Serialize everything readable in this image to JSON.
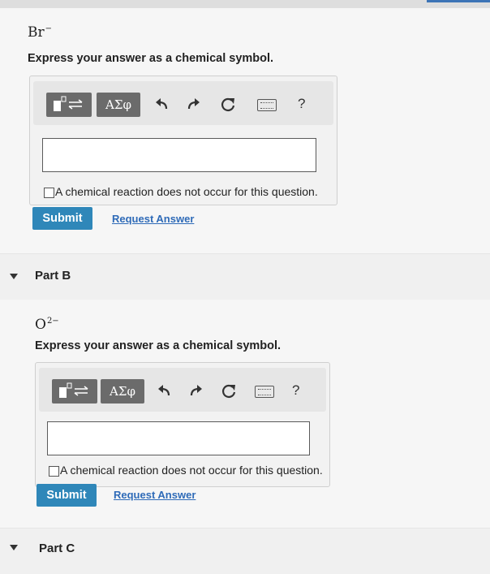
{
  "partA": {
    "ion_base": "Br",
    "ion_charge": "−",
    "prompt": "Express your answer as a chemical symbol.",
    "toolbar": {
      "greek_label": "ΑΣφ",
      "help_label": "?"
    },
    "answer_value": "",
    "no_reaction_label": "A chemical reaction does not occur for this question.",
    "submit_label": "Submit",
    "request_label": "Request Answer"
  },
  "partB": {
    "title": "Part B",
    "ion_base": "O",
    "ion_charge": "2−",
    "prompt": "Express your answer as a chemical symbol.",
    "toolbar": {
      "greek_label": "ΑΣφ",
      "help_label": "?"
    },
    "answer_value": "",
    "no_reaction_label": "A chemical reaction does not occur for this question.",
    "submit_label": "Submit",
    "request_label": "Request Answer"
  },
  "partC": {
    "title": "Part C"
  },
  "colors": {
    "submit": "#2f87b9",
    "link": "#2f6bb8",
    "toolbar_button": "#6b6b6b"
  },
  "icons": [
    "template-icon",
    "undo-icon",
    "redo-icon",
    "reset-icon",
    "keyboard-icon",
    "help-icon",
    "collapse-triangle-icon"
  ]
}
